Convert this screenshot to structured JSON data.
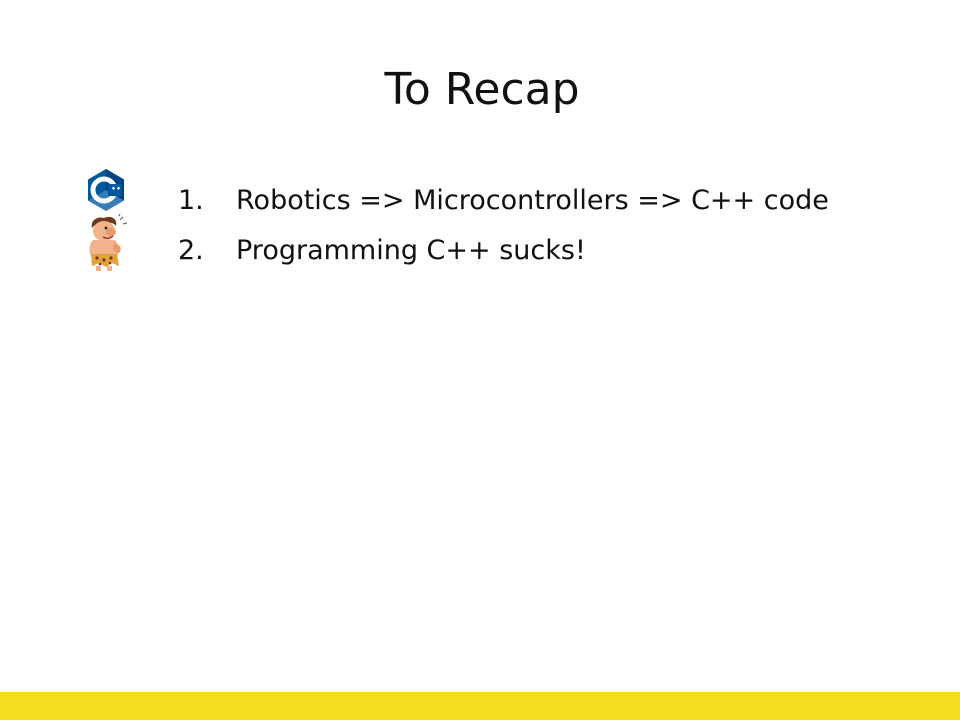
{
  "slide": {
    "title": "To Recap",
    "items": [
      {
        "number": "1.",
        "text": "Robotics => Microcontrollers => C++ code",
        "icon": "cpp-logo-icon"
      },
      {
        "number": "2.",
        "text": "Programming C++ sucks!",
        "icon": "caveman-icon"
      }
    ]
  },
  "colors": {
    "footer_bar": "#f5dc1e",
    "cpp_logo": "#00599c",
    "text": "#111111",
    "background": "#ffffff"
  }
}
